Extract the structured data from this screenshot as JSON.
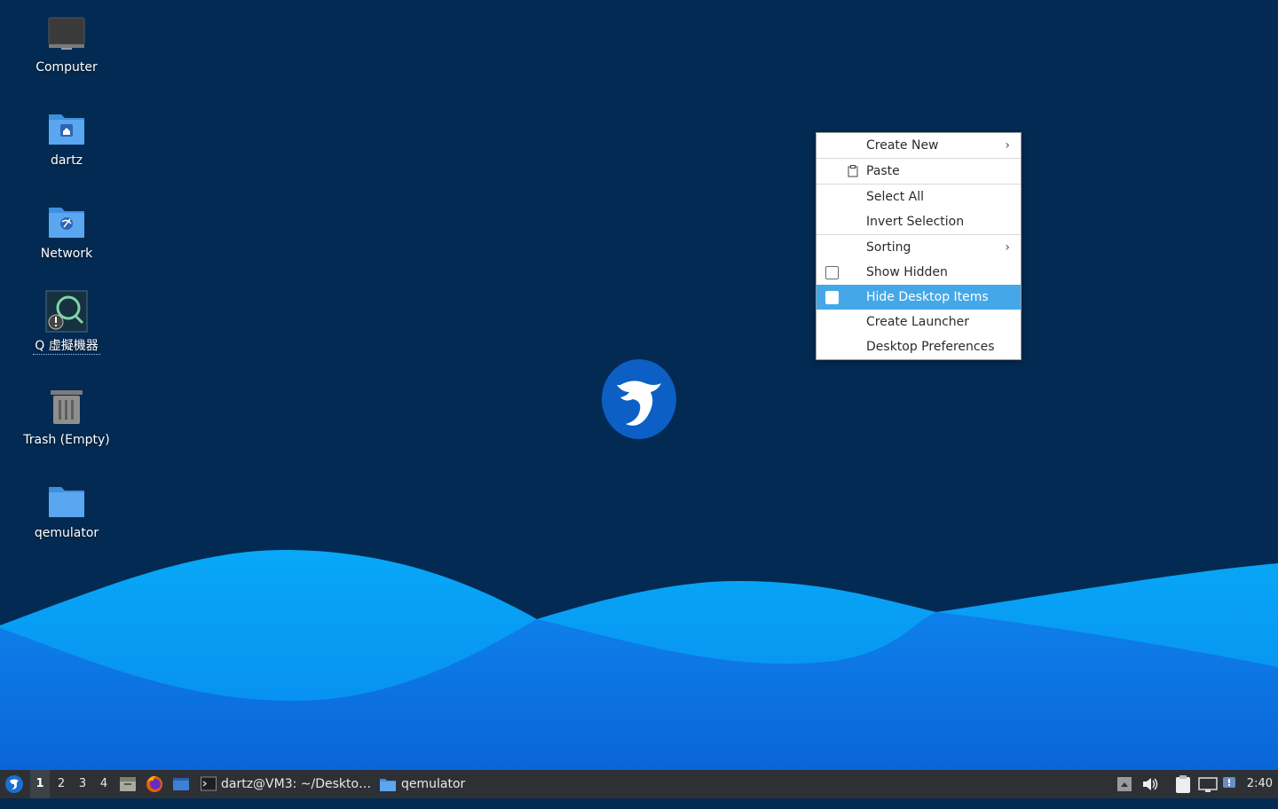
{
  "desktop": {
    "icons": [
      {
        "label": "Computer",
        "icon": "computer-icon"
      },
      {
        "label": "dartz",
        "icon": "home-folder-icon"
      },
      {
        "label": "Network",
        "icon": "network-folder-icon"
      },
      {
        "label": "Q 虛擬機器",
        "icon": "qemulator-app-icon"
      },
      {
        "label": "Trash (Empty)",
        "icon": "trash-icon"
      },
      {
        "label": "qemulator",
        "icon": "folder-icon"
      }
    ]
  },
  "context_menu": {
    "items": [
      {
        "label": "Create New",
        "submenu": true
      },
      {
        "label": "Paste",
        "icon": "paste-icon"
      },
      {
        "label": "Select All"
      },
      {
        "label": "Invert Selection"
      },
      {
        "label": "Sorting",
        "submenu": true
      },
      {
        "label": "Show Hidden",
        "checkbox": true,
        "checked": false
      },
      {
        "label": "Hide Desktop Items",
        "checkbox": true,
        "checked": false,
        "highlighted": true
      },
      {
        "label": "Create Launcher"
      },
      {
        "label": "Desktop Preferences"
      }
    ]
  },
  "taskbar": {
    "workspaces": [
      "1",
      "2",
      "3",
      "4"
    ],
    "active_workspace": "1",
    "launchers": [
      "lubuntu-menu-icon",
      "file-manager-icon",
      "firefox-icon",
      "desktop-icon"
    ],
    "tasks": [
      {
        "label": "dartz@VM3: ~/Deskto…",
        "icon": "terminal-icon"
      },
      {
        "label": "qemulator",
        "icon": "folder-icon"
      }
    ],
    "tray": [
      "update-icon",
      "volume-icon",
      "clipboard-icon",
      "network-icon",
      "notification-icon"
    ],
    "clock": "2:40"
  },
  "colors": {
    "background": "#032a52",
    "wave_light": "#0aa0f2",
    "wave_dark": "#0a74e0",
    "menu_highlight": "#44a8e8",
    "taskbar": "#2d3136"
  }
}
